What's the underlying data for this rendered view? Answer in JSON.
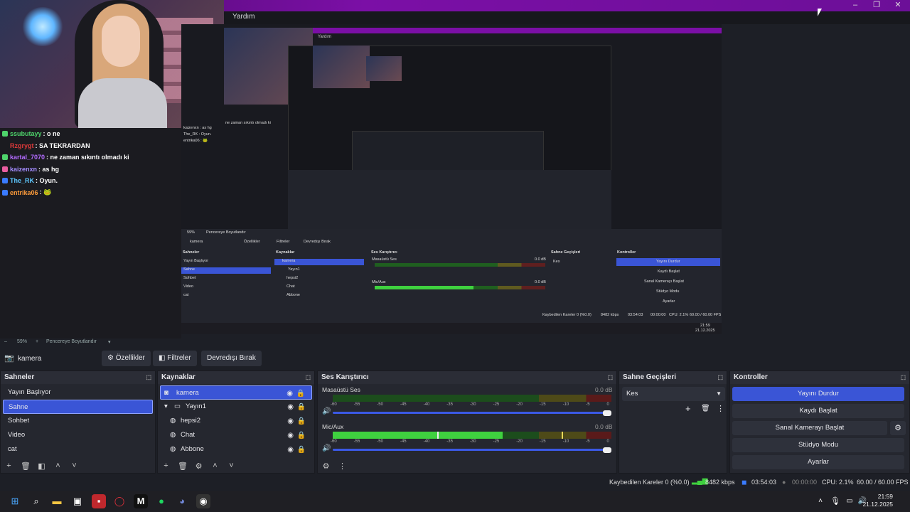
{
  "menu": {
    "help": "Yardım"
  },
  "window_controls": {
    "minimize": "–",
    "maximize": "❐",
    "close": "✕"
  },
  "chat": [
    {
      "user": "ssubutayy",
      "color": "#4ed46b",
      "text": ": o ne",
      "badge": "#4ed46b"
    },
    {
      "user": "Rzgrygt",
      "color": "#e03a3a",
      "text": ": SA TEKRARDAN",
      "badge": ""
    },
    {
      "user": "kartal_7070",
      "color": "#b36bff",
      "text": ": ne zaman sıkıntı olmadı ki",
      "badge": "#4ed46b"
    },
    {
      "user": "kaizenxn",
      "color": "#a48cff",
      "text": ": as hg",
      "badge": "#e85da0"
    },
    {
      "user": "The_RK",
      "color": "#5ec8ff",
      "text": ": Oyun.",
      "badge": "#3a7bff"
    },
    {
      "user": "entrika06",
      "color": "#ff9c3a",
      "text": ": 🐸",
      "badge": "#3a7bff"
    }
  ],
  "preview": {
    "inner_help": "Yardım",
    "inner_chat": [
      "kaizenxn : as hg",
      "The_RK : Oyun.",
      "entrika06 : 🐸"
    ],
    "inner_tail": "ne zaman sıkıntı olmadı ki",
    "inner_zoom": "59%",
    "inner_fit": "Pencereye Boyutlandır",
    "inner_source": "kamera",
    "inner_props": "Özellikler",
    "inner_filters": "Filtreler",
    "inner_disable": "Devredışı Bırak",
    "inner_scenes_title": "Sahneler",
    "inner_scenes": [
      "Yayın Başlıyor",
      "Sahne",
      "Sohbet",
      "Video",
      "cat"
    ],
    "inner_sources_title": "Kaynaklar",
    "inner_sources": [
      "kamera",
      "Yayın1",
      "hepsi2",
      "Chat",
      "Abbone"
    ],
    "inner_mixer_title": "Ses Karıştırıcı",
    "inner_desktop": "Masaüstü Ses",
    "inner_mic": "Mic/Aux",
    "inner_db": "0.0 dB",
    "inner_trans_title": "Sahne Geçişleri",
    "inner_trans": "Kes",
    "inner_ctl_title": "Kontroller",
    "inner_ctl": [
      "Yayını Durdur",
      "Kaydı Başlat",
      "Sanal Kamerayı Başlat",
      "Stüdyo Modu",
      "Ayarlar"
    ],
    "inner_status": "Kaybedilen Kareler 0 (%0.0)",
    "inner_kbps": "8482 kbps",
    "inner_time": "03:54:03",
    "inner_rec": "00:00:00",
    "inner_cpu": "CPU: 2.1%",
    "inner_fps": "60.00 / 60.00 FPS",
    "inner_clock_time": "21:59",
    "inner_clock_date": "21.12.2025"
  },
  "zoom": {
    "level": "59%",
    "fit": "Pencereye Boyutlandır"
  },
  "toolbar": {
    "source": "kamera",
    "properties": "Özellikler",
    "filters": "Filtreler",
    "disable": "Devredışı Bırak"
  },
  "scenes": {
    "title": "Sahneler",
    "items": [
      "Yayın Başlıyor",
      "Sahne",
      "Sohbet",
      "Video",
      "cat"
    ],
    "selected": 1
  },
  "sources": {
    "title": "Kaynaklar",
    "items": [
      "kamera",
      "Yayın1",
      "hepsi2",
      "Chat",
      "Abbone"
    ]
  },
  "mixer": {
    "title": "Ses Karıştırıcı",
    "channels": [
      {
        "name": "Masaüstü Ses",
        "db": "0.0 dB",
        "level": 0
      },
      {
        "name": "Mic/Aux",
        "db": "0.0 dB",
        "level": 0.62
      }
    ],
    "ticks": [
      "-60",
      "-55",
      "-50",
      "-45",
      "-40",
      "-35",
      "-30",
      "-25",
      "-20",
      "-15",
      "-10",
      "-5",
      "0"
    ]
  },
  "transitions": {
    "title": "Sahne Geçişleri",
    "selected": "Kes"
  },
  "controls": {
    "title": "Kontroller",
    "stop_stream": "Yayını Durdur",
    "start_record": "Kaydı Başlat",
    "virtual_cam": "Sanal Kamerayı Başlat",
    "studio_mode": "Stüdyo Modu",
    "settings": "Ayarlar"
  },
  "status": {
    "dropped": "Kaybedilen Kareler 0 (%0.0)",
    "kbps": "8482 kbps",
    "stream_time": "03:54:03",
    "rec_time": "00:00:00",
    "cpu": "CPU: 2.1%",
    "fps": "60.00 / 60.00 FPS"
  },
  "clock": {
    "time": "21:59",
    "date": "21.12.2025"
  },
  "colors": {
    "accent": "#3a55d6",
    "titlebar": "#7b0fa6",
    "meter_green": "#3fd13f",
    "meter_yellow": "#d6c02a",
    "meter_red": "#d63030"
  }
}
